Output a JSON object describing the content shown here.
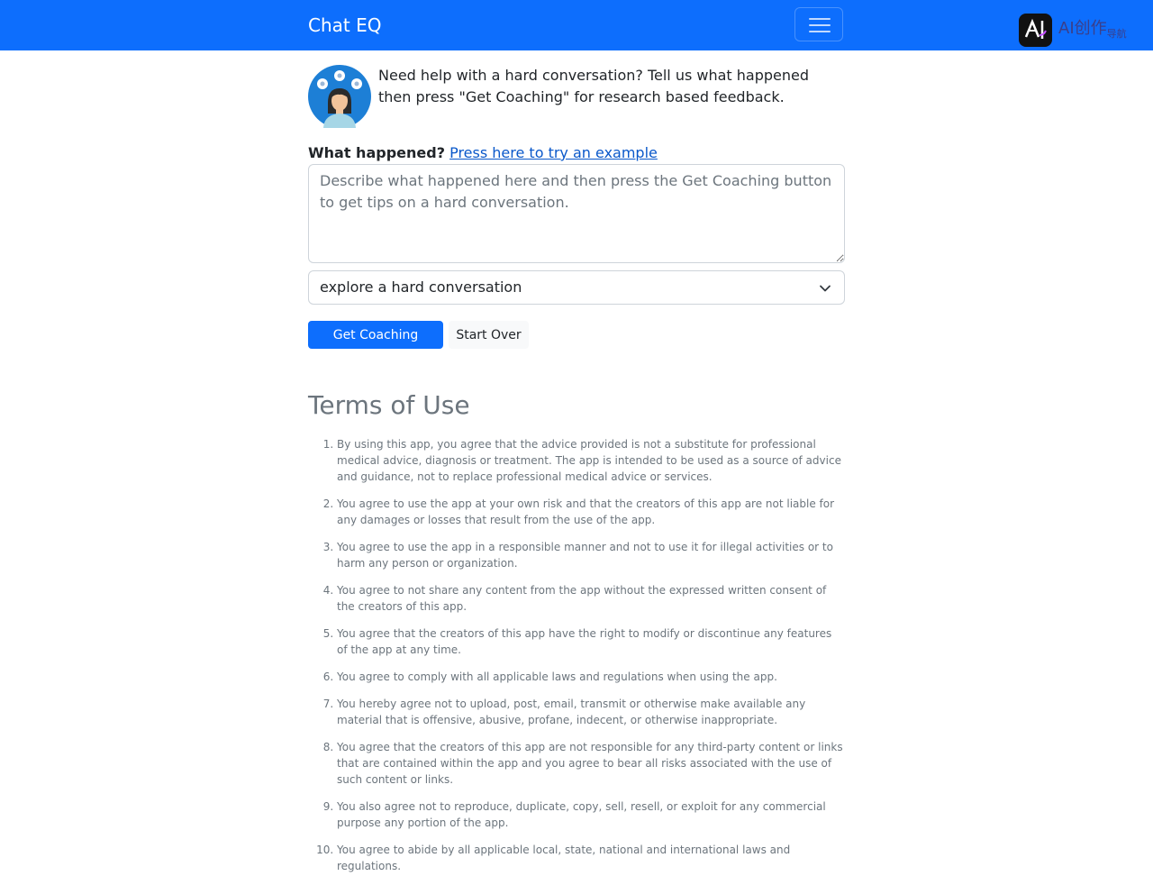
{
  "navbar": {
    "brand": "Chat EQ",
    "logo_text": "AI创作",
    "logo_subtext": "导航",
    "accent_color": "#0d6efd"
  },
  "intro": {
    "text": "Need help with a hard conversation? Tell us what happened then press \"Get Coaching\" for research based feedback."
  },
  "form": {
    "label": "What happened?",
    "example_link": "Press here to try an example",
    "placeholder": "Describe what happened here and then press the Get Coaching button to get tips on a hard conversation.",
    "mode_selected": "explore a hard conversation",
    "get_coaching_label": "Get Coaching",
    "start_over_label": "Start Over"
  },
  "terms": {
    "title": "Terms of Use",
    "items": [
      "By using this app, you agree that the advice provided is not a substitute for professional medical advice, diagnosis or treatment. The app is intended to be used as a source of advice and guidance, not to replace professional medical advice or services.",
      "You agree to use the app at your own risk and that the creators of this app are not liable for any damages or losses that result from the use of the app.",
      "You agree to use the app in a responsible manner and not to use it for illegal activities or to harm any person or organization.",
      "You agree to not share any content from the app without the expressed written consent of the creators of this app.",
      "You agree that the creators of this app have the right to modify or discontinue any features of the app at any time.",
      "You agree to comply with all applicable laws and regulations when using the app.",
      "You hereby agree not to upload, post, email, transmit or otherwise make available any material that is offensive, abusive, profane, indecent, or otherwise inappropriate.",
      "You agree that the creators of this app are not responsible for any third-party content or links that are contained within the app and you agree to bear all risks associated with the use of such content or links.",
      "You also agree not to reproduce, duplicate, copy, sell, resell, or exploit for any commercial purpose any portion of the app.",
      "You agree to abide by all applicable local, state, national and international laws and regulations."
    ]
  }
}
